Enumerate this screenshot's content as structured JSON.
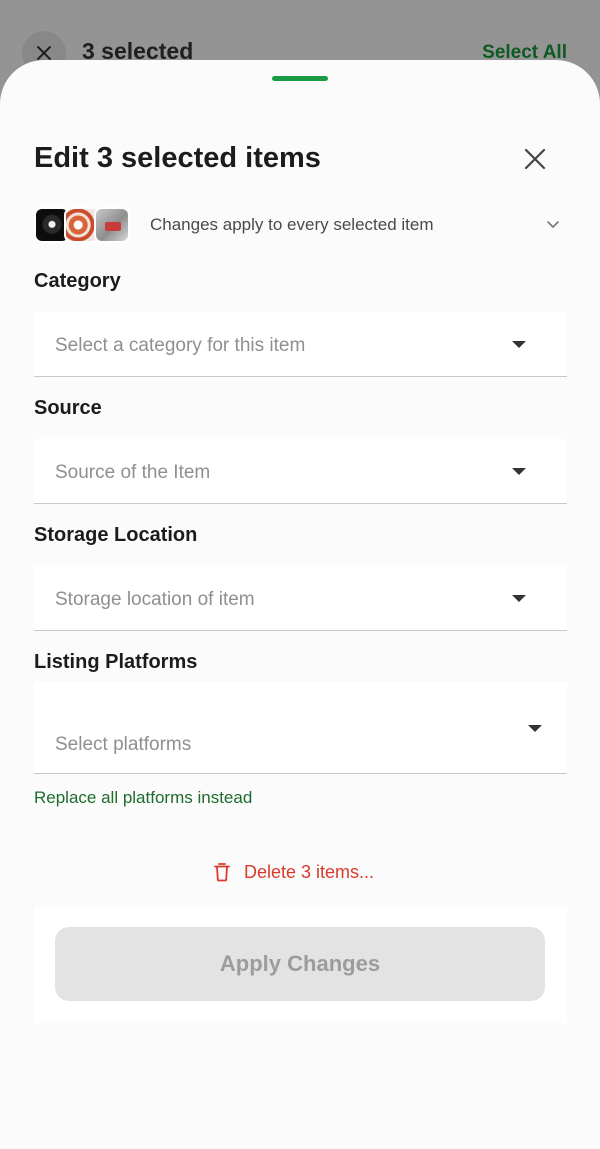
{
  "appbar": {
    "title": "3 selected",
    "select_all_label": "Select All",
    "close_icon": "close-icon"
  },
  "sheet": {
    "title": "Edit 3 selected items",
    "close_icon": "close-icon",
    "thumbnails_note": "Changes apply to every selected item",
    "expand_icon": "chevron-down-icon"
  },
  "fields": {
    "category": {
      "label": "Category",
      "placeholder": "Select a category for this item"
    },
    "source": {
      "label": "Source",
      "placeholder": "Source of the Item"
    },
    "storage": {
      "label": "Storage Location",
      "placeholder": "Storage location of item"
    },
    "platforms": {
      "label": "Listing Platforms",
      "placeholder": "Select platforms"
    }
  },
  "replace_link": "Replace all platforms instead",
  "delete_label": "Delete 3 items...",
  "apply_label": "Apply Changes",
  "colors": {
    "accent_green": "#1b9a45",
    "link_green": "#1f6b2e",
    "danger_red": "#d93a2b",
    "disabled_button": "#e3e3e3"
  }
}
